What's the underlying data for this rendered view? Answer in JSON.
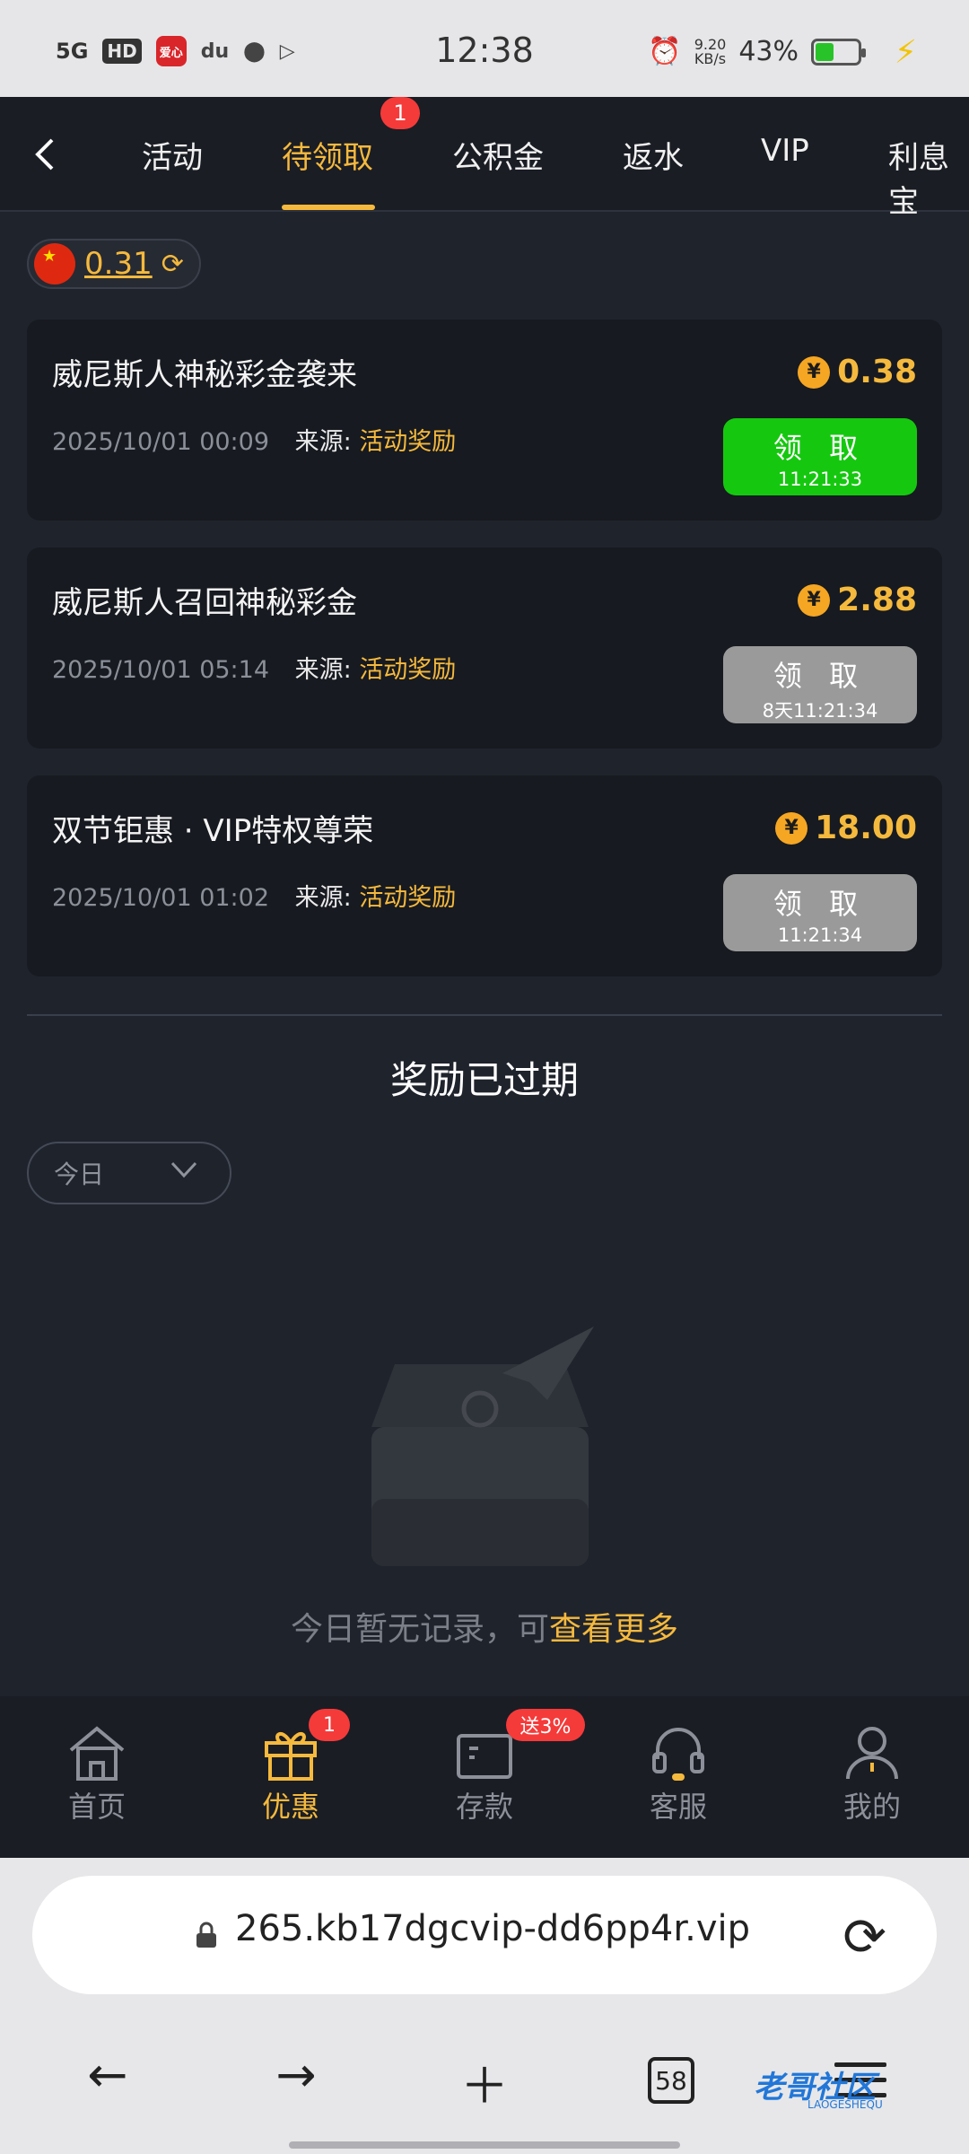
{
  "status_bar": {
    "network": "5G",
    "hd": "HD",
    "app_icon_text": "爱心",
    "du": "du",
    "time": "12:38",
    "speed_value": "9.20",
    "speed_unit": "KB/s",
    "battery": "43%",
    "battery_level": 0.43
  },
  "nav": {
    "tabs": [
      "活动",
      "待领取",
      "公积金",
      "返水",
      "VIP",
      "利息宝"
    ],
    "active_tab": "待领取",
    "badge": "1"
  },
  "balance": {
    "value": "0.31"
  },
  "rewards": [
    {
      "title": "威尼斯人神秘彩金袭来",
      "date": "2025/10/01 00:09",
      "source_label": "来源:",
      "source": "活动奖励",
      "amount": "0.38",
      "button_label": "领 取",
      "timer": "11:21:33",
      "state": "active"
    },
    {
      "title": "威尼斯人召回神秘彩金",
      "date": "2025/10/01 05:14",
      "source_label": "来源:",
      "source": "活动奖励",
      "amount": "2.88",
      "button_label": "领 取",
      "timer": "8天11:21:34",
      "state": "disabled"
    },
    {
      "title": "双节钜惠 · VIP特权尊荣",
      "date": "2025/10/01 01:02",
      "source_label": "来源:",
      "source": "活动奖励",
      "amount": "18.00",
      "button_label": "领 取",
      "timer": "11:21:34",
      "state": "disabled"
    }
  ],
  "coin_symbol": "¥",
  "expired": {
    "title": "奖励已过期",
    "filter_value": "今日",
    "empty_text": "今日暂无记录，可",
    "empty_link": "查看更多"
  },
  "bottom_tabs": [
    {
      "label": "首页",
      "icon": "home-icon"
    },
    {
      "label": "优惠",
      "icon": "gift-icon",
      "badge": "1",
      "active": true
    },
    {
      "label": "存款",
      "icon": "wallet-icon",
      "badge": "送3%"
    },
    {
      "label": "客服",
      "icon": "headset-icon"
    },
    {
      "label": "我的",
      "icon": "user-icon"
    }
  ],
  "browser": {
    "url": "265.kb17dgcvip-dd6pp4r.vip",
    "tab_count": "58",
    "watermark": "老哥社区",
    "watermark_sub": "LAOGESHEQU"
  },
  "colors": {
    "accent": "#f5b93d",
    "green": "#15c80f",
    "badge": "#f53a3a",
    "bg": "#1f232c"
  }
}
